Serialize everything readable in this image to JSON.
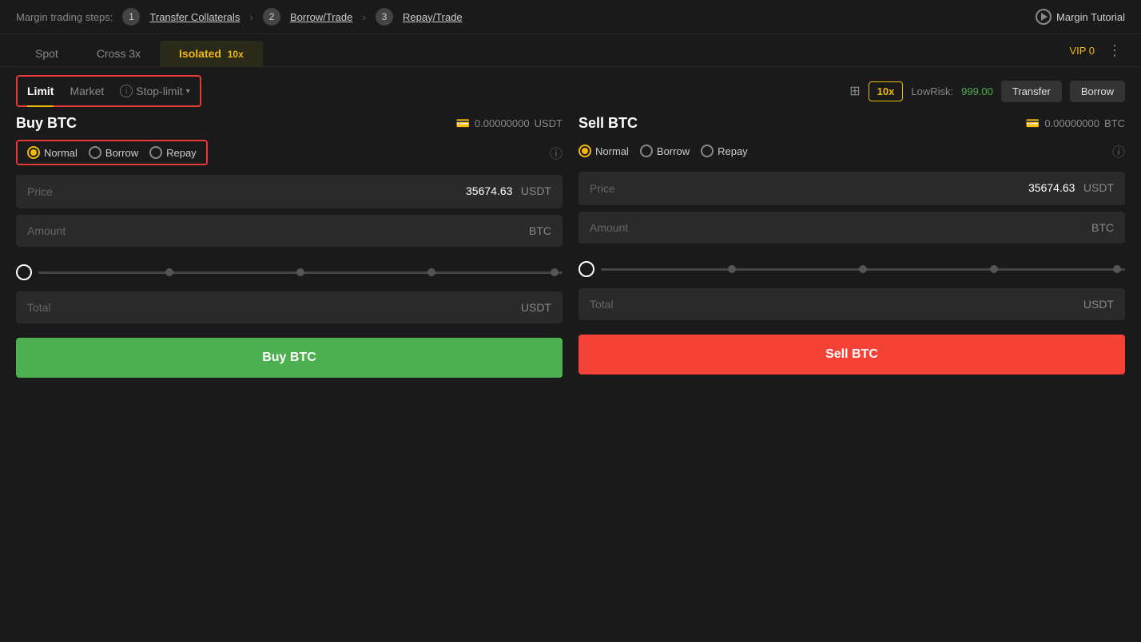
{
  "topBar": {
    "label": "Margin trading steps:",
    "steps": [
      {
        "number": "1",
        "label": "Transfer Collaterals"
      },
      {
        "number": "2",
        "label": "Borrow/Trade"
      },
      {
        "number": "3",
        "label": "Repay/Trade"
      }
    ],
    "tutorial": "Margin Tutorial"
  },
  "tabs": {
    "spot": "Spot",
    "cross": "Cross 3x",
    "isolated": "Isolated",
    "isolatedBadge": "10x",
    "vip": "VIP 0"
  },
  "orderType": {
    "limit": "Limit",
    "market": "Market",
    "stopLimit": "Stop-limit"
  },
  "rightControls": {
    "leverage": "10x",
    "lowRiskLabel": "LowRisk:",
    "lowRiskValue": "999.00",
    "transfer": "Transfer",
    "borrow": "Borrow"
  },
  "buyPanel": {
    "title": "Buy BTC",
    "balance": "0.00000000",
    "balanceCurrency": "USDT",
    "modes": {
      "normal": "Normal",
      "borrow": "Borrow",
      "repay": "Repay"
    },
    "price": {
      "label": "Price",
      "value": "35674.63",
      "currency": "USDT"
    },
    "amount": {
      "label": "Amount",
      "value": "",
      "currency": "BTC"
    },
    "total": {
      "label": "Total",
      "value": "",
      "currency": "USDT"
    },
    "button": "Buy BTC"
  },
  "sellPanel": {
    "title": "Sell BTC",
    "balance": "0.00000000",
    "balanceCurrency": "BTC",
    "modes": {
      "normal": "Normal",
      "borrow": "Borrow",
      "repay": "Repay"
    },
    "price": {
      "label": "Price",
      "value": "35674.63",
      "currency": "USDT"
    },
    "amount": {
      "label": "Amount",
      "value": "",
      "currency": "BTC"
    },
    "total": {
      "label": "Total",
      "value": "",
      "currency": "USDT"
    },
    "button": "Sell BTC"
  }
}
